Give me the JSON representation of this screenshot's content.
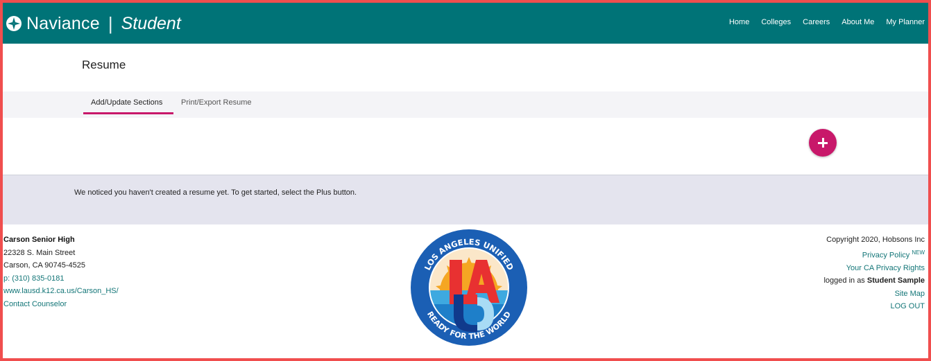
{
  "header": {
    "brand": "Naviance",
    "separator": "|",
    "product": "Student",
    "nav": [
      "Home",
      "Colleges",
      "Careers",
      "About Me",
      "My Planner"
    ]
  },
  "page": {
    "title": "Resume"
  },
  "tabs": {
    "active": "Add/Update Sections",
    "other": "Print/Export Resume"
  },
  "notice": "We noticed you haven't created a resume yet. To get started, select the Plus button.",
  "footer": {
    "school": "Carson Senior High",
    "address1": "22328 S. Main Street",
    "address2": "Carson, CA 90745-4525",
    "phone": "p: (310) 835-0181",
    "website": "www.lausd.k12.ca.us/Carson_HS/",
    "contact": "Contact Counselor",
    "copyright": "Copyright 2020, Hobsons Inc",
    "privacy": "Privacy Policy",
    "privacy_badge": "NEW",
    "ca_privacy": "Your CA Privacy Rights",
    "logged_in_prefix": "logged in as",
    "user": "Student Sample",
    "sitemap": "Site Map",
    "logout": "LOG OUT"
  },
  "logo": {
    "top_text": "LOS ANGELES UNIFIED",
    "bottom_text": "READY FOR THE WORLD",
    "mark": "LAUSD"
  },
  "colors": {
    "header_bg": "#007377",
    "accent": "#c8186a",
    "link": "#127577",
    "notice_bg": "#e4e4ee",
    "frame_border": "#f04e4e"
  }
}
